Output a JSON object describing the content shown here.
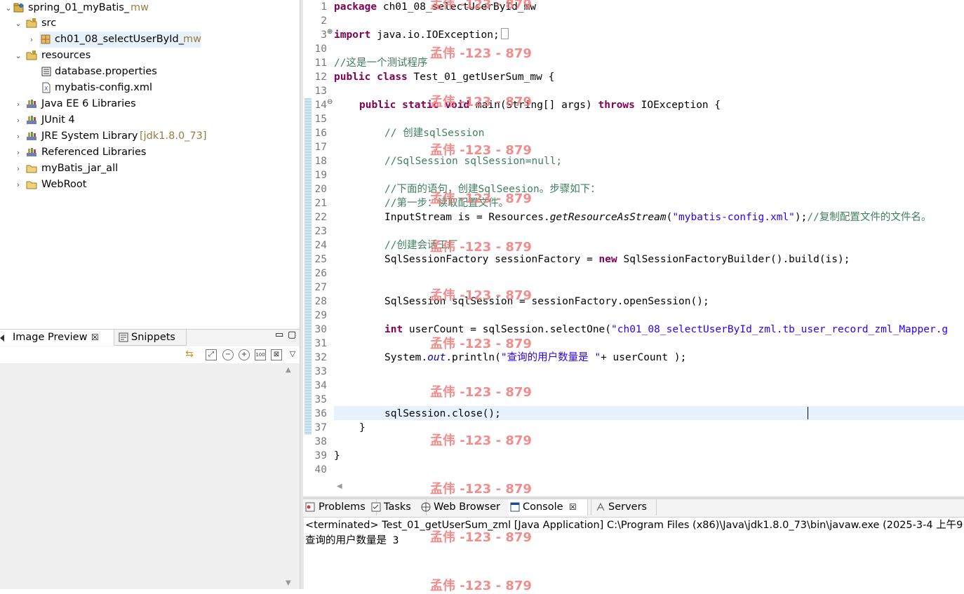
{
  "explorer": {
    "project": {
      "name": "spring_01_myBatis_",
      "decoration": "mw"
    },
    "items": [
      {
        "label": "src",
        "decoration": ""
      },
      {
        "label": "ch01_08_selectUserById_",
        "decoration": "mw"
      },
      {
        "label": "resources",
        "decoration": ""
      },
      {
        "label": "database.properties",
        "decoration": ""
      },
      {
        "label": "mybatis-config.xml",
        "decoration": ""
      },
      {
        "label": "Java EE 6 Libraries",
        "decoration": ""
      },
      {
        "label": "JUnit 4",
        "decoration": ""
      },
      {
        "label": "JRE System Library",
        "decoration": "[jdk1.8.0_73]"
      },
      {
        "label": "Referenced Libraries",
        "decoration": ""
      },
      {
        "label": "myBatis_jar_all",
        "decoration": ""
      },
      {
        "label": "WebRoot",
        "decoration": ""
      }
    ]
  },
  "preview": {
    "tabs": [
      {
        "label": "Image Preview",
        "close": "☒"
      },
      {
        "label": "Snippets"
      }
    ]
  },
  "editor": {
    "line_numbers": [
      "1",
      "2",
      "3",
      "10",
      "11",
      "12",
      "13",
      "14",
      "15",
      "16",
      "17",
      "18",
      "19",
      "20",
      "21",
      "22",
      "23",
      "24",
      "25",
      "26",
      "27",
      "28",
      "29",
      "30",
      "31",
      "32",
      "33",
      "34",
      "35",
      "36",
      "37",
      "38",
      "39",
      "40"
    ],
    "fold_markers": {
      "3": "⊕",
      "14": "⊖"
    },
    "lines": {
      "l1_kw": "package",
      "l1_rest": " ch01_08_selectUserById_mw",
      "l3_kw": "import",
      "l3_rest": " java.io.IOException;",
      "l11": "//这是一个测试程序",
      "l12_kw1": "public",
      "l12_kw2": "class",
      "l12_rest": " Test_01_getUserSum_mw {",
      "l14_kw1": "public",
      "l14_kw2": "static",
      "l14_kw3": "void",
      "l14_mid": " main(String[] args) ",
      "l14_kw4": "throws",
      "l14_rest": " IOException {",
      "l16": "// 创建sqlSession",
      "l18": "//SqlSession sqlSession=null;",
      "l20": "//下面的语句，创建SqlSeesion。步骤如下：",
      "l21": "//第一步：读取配置文件。",
      "l22_a": "InputStream is = Resources.",
      "l22_method": "getResourceAsStream",
      "l22_b": "(",
      "l22_str": "\"mybatis-config.xml\"",
      "l22_c": ");",
      "l22_cm": "//复制配置文件的文件名。",
      "l24": "//创建会话工厂",
      "l25_a": "SqlSessionFactory sessionFactory = ",
      "l25_kw": "new",
      "l25_b": " SqlSessionFactoryBuilder().build(is);",
      "l28": "SqlSession sqlSession = sessionFactory.openSession();",
      "l30_kw": "int",
      "l30_a": " userCount = sqlSession.selectOne(",
      "l30_str": "\"ch01_08_selectUserById_zml.tb_user_record_zml_Mapper.g",
      "l32_a": "System.",
      "l32_field": "out",
      "l32_b": ".println(",
      "l32_str": "\"查询的用户数量是 \"",
      "l32_c": "+ userCount );",
      "l36": "sqlSession.close();",
      "l37": "}",
      "l39": "}"
    }
  },
  "console": {
    "tabs": [
      {
        "label": "Problems"
      },
      {
        "label": "Tasks"
      },
      {
        "label": "Web Browser"
      },
      {
        "label": "Console",
        "close": "☒"
      },
      {
        "label": "Servers"
      }
    ],
    "header": "<terminated> Test_01_getUserSum_zml [Java Application] C:\\Program Files (x86)\\Java\\jdk1.8.0_73\\bin\\javaw.exe (2025-3-4 上午9:",
    "output": "查询的用户数量是 3"
  },
  "watermark": {
    "text": "孟伟 -123 - 879"
  },
  "colors": {
    "keyword": "#7f0055",
    "comment": "#3f7f5f",
    "string": "#2a00ff",
    "watermark": "#f07a7a"
  }
}
